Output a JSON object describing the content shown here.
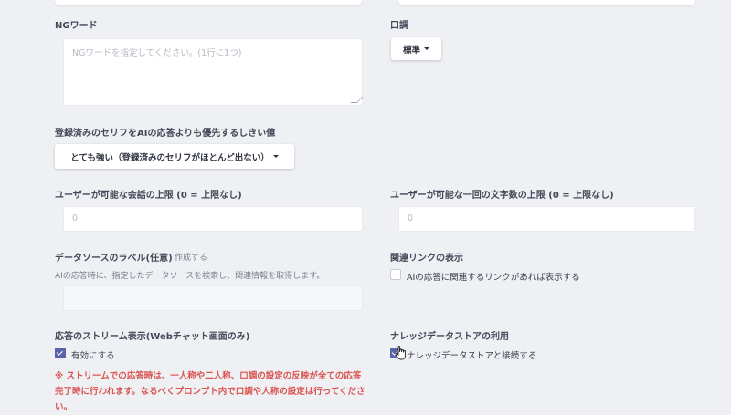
{
  "ng_words": {
    "label": "NGワード",
    "placeholder": "NGワードを指定してください。(1行に1つ)"
  },
  "tone": {
    "label": "口調",
    "value": "標準"
  },
  "threshold": {
    "label": "登録済みのセリフをAIの応答よりも優先するしきい値",
    "value": "とても強い（登録済みのセリフがほとんど出ない）"
  },
  "conversation_limit": {
    "label": "ユーザーが可能な会話の上限 (0 = 上限なし)",
    "value": "0"
  },
  "char_limit": {
    "label": "ユーザーが可能な一回の文字数の上限 (0 = 上限なし)",
    "value": "0"
  },
  "datasource": {
    "label": "データソースのラベル(任意)",
    "create_link": "作成する",
    "description": "AIの応答時に、指定したデータソースを検索し、関連情報を取得します。"
  },
  "related_links": {
    "label": "関連リンクの表示",
    "checkbox_label": "AIの応答に関連するリンクがあれば表示する",
    "checked": false
  },
  "stream": {
    "label": "応答のストリーム表示(Webチャット画面のみ)",
    "checkbox_label": "有効にする",
    "checked": true,
    "warning_line1": "※ ストリームでの応答時は、一人称や二人称、口調の設定の反映が全ての応答",
    "warning_line2": "完了時に行われます。なるべくプロンプト内で口調や人称の設定は行ってくださ",
    "warning_line3": "い。"
  },
  "knowledge": {
    "label": "ナレッジデータストアの利用",
    "checkbox_label": "ナレッジデータストアと接続する",
    "checked": true
  },
  "colors": {
    "accent": "#5a64a8",
    "warning": "#d9534f",
    "background": "#eef0f4"
  }
}
